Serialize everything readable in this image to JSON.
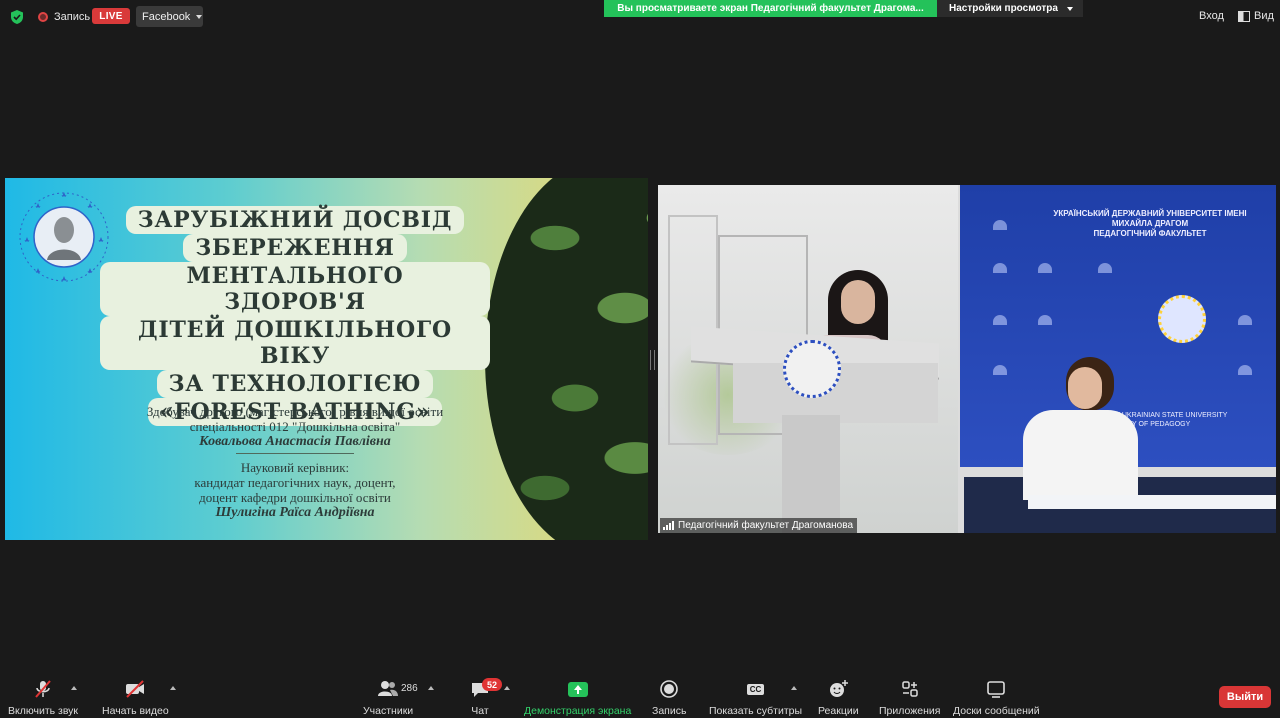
{
  "topbar": {
    "recording_label": "Запись",
    "live_badge": "LIVE",
    "stream_target": "Facebook",
    "share_banner": "Вы просматриваете экран Педагогічний факультет Драгома...",
    "view_settings": "Настройки просмотра",
    "login_label": "Вход",
    "view_label": "Вид"
  },
  "slide": {
    "title_lines": [
      "ЗАРУБІЖНИЙ ДОСВІД",
      "ЗБЕРЕЖЕННЯ",
      "МЕНТАЛЬНОГО ЗДОРОВ'Я",
      "ДІТЕЙ ДОШКІЛЬНОГО ВІКУ",
      "ЗА ТЕХНОЛОГІЄЮ",
      "«FOREST BATHING»"
    ],
    "student_line1": "Здобувач другого (магістерського) рівня вищої освіти",
    "student_line2": "спеціальності 012 \"Дошкільна освіта\"",
    "student_name": "Ковальова Анастасія Павлівна",
    "supervisor_heading": "Науковий керівник:",
    "supervisor_line1": "кандидат педагогічних наук, доцент,",
    "supervisor_line2": "доцент кафедри дошкільної освіти",
    "supervisor_name": "Шулигіна Раїса Андріївна"
  },
  "video": {
    "participant_name": "Педагогічний факультет Драгоманова",
    "banner_title_line1": "УКРАЇНСЬКИЙ ДЕРЖАВНИЙ УНІВЕРСИТЕТ ІМЕНІ МИХАЙЛА ДРАГОМ",
    "banner_title_line2": "ПЕДАГОГІЧНИЙ ФАКУЛЬТЕТ",
    "banner_sub_line1": "DRAGOMANOV UKRAINIAN STATE UNIVERSITY",
    "banner_sub_line2": "FACULTY OF PEDAGOGY"
  },
  "toolbar": {
    "mute_label": "Включить звук",
    "video_label": "Начать видео",
    "participants_count": "286",
    "participants_label": "Участники",
    "chat_badge": "52",
    "chat_label": "Чат",
    "share_label": "Демонстрация экрана",
    "record_label": "Запись",
    "subtitles_icon_text": "CC",
    "subtitles_label": "Показать субтитры",
    "reactions_label": "Реакции",
    "apps_label": "Приложения",
    "whiteboards_label": "Доски сообщений",
    "leave_label": "Выйти"
  },
  "colors": {
    "share_green": "#24c25a",
    "live_red": "#d93a3a",
    "leave_red": "#d93636",
    "background": "#1a1a1a"
  }
}
